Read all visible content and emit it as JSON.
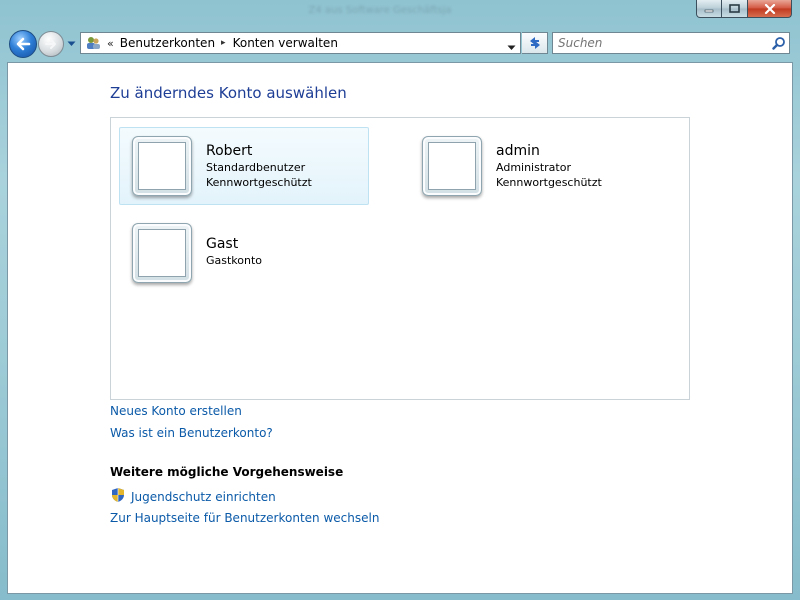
{
  "window": {
    "title_blur": "Z4 aus Software Geschäftsja",
    "caption_buttons": [
      "minimize",
      "maximize",
      "close"
    ]
  },
  "navigation": {
    "back_icon": "back-arrow-icon",
    "forward_icon": "forward-arrow-icon",
    "address_icon": "user-accounts-icon",
    "overflow": "«",
    "breadcrumbs": [
      {
        "label": "Benutzerkonten"
      },
      {
        "label": "Konten verwalten"
      }
    ],
    "search_placeholder": "Suchen"
  },
  "main": {
    "heading": "Zu änderndes Konto auswählen",
    "accounts": [
      {
        "name": "Robert",
        "type": "Standardbenutzer",
        "status": "Kennwortgeschützt",
        "selected": true
      },
      {
        "name": "admin",
        "type": "Administrator",
        "status": "Kennwortgeschützt",
        "selected": false
      },
      {
        "name": "Gast",
        "type": "Gastkonto",
        "status": "",
        "selected": false
      }
    ],
    "links": {
      "new_account": "Neues Konto erstellen",
      "what_is_account": "Was ist ein Benutzerkonto?"
    },
    "more_section": {
      "title": "Weitere mögliche Vorgehensweise",
      "parental_controls": "Jugendschutz einrichten",
      "parental_icon": "shield-icon",
      "main_page": "Zur Hauptseite für Benutzerkonten wechseln"
    }
  },
  "colors": {
    "link": "#0b5aa8",
    "heading": "#1e3e96",
    "selection": "#e3f3fb"
  }
}
